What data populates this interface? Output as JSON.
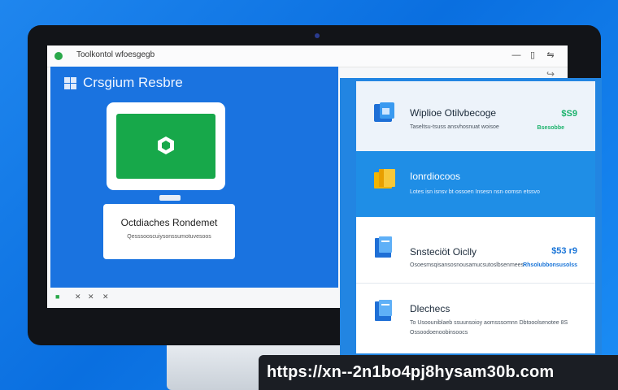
{
  "window": {
    "title": "Toolkontol wfoesgegb",
    "minimize": "—",
    "maximize": "▯",
    "close": "⇋",
    "share_icon": "share-icon"
  },
  "left_panel": {
    "app_name": "Crsgium Resbre",
    "card": {
      "title": "Octdiaches Rondemet",
      "subtitle": "Qesssooscuiysonssumotuvesoos"
    }
  },
  "taskbar": {
    "icons": [
      "✕",
      "✕",
      "✕"
    ]
  },
  "right_panel": {
    "rows": [
      {
        "title": "Wiplioe Otilvbecoge",
        "subtitle": "Taseltsu-tsuss ansvhosnuat woisoe",
        "price": "$S9",
        "price_sub": "Bsesobbe",
        "icon": "window-icon"
      },
      {
        "title": "Ionrdiocoos",
        "subtitle": "Lotes isn  isnsv  bt·ossoen  Insesn  nsn·oomsn  etssvo",
        "price": "",
        "price_sub": "",
        "icon": "folder-icon"
      },
      {
        "title": "Snsteciöt Oiclly",
        "subtitle": "Osoesmsqisansosnousamucsutoslbsenmees",
        "price": "$53 r9",
        "price_sub": "Rhsolubbonsusolss",
        "icon": "document-icon"
      },
      {
        "title": "Dlechecs",
        "subtitle": "To Usoouniblaeb ssuunsoioy aomsssomnn Dbtooolsenotee 8S",
        "subtitle2": "Ossoodoenoobinsoocs",
        "price": "",
        "price_sub": "",
        "icon": "document-icon"
      }
    ]
  },
  "url": "https://xn--2n1bo4pj8hysam30b.com",
  "colors": {
    "background": "#1a7fea",
    "accent_green": "#1bb26b",
    "panel_blue": "#1a73e0"
  }
}
